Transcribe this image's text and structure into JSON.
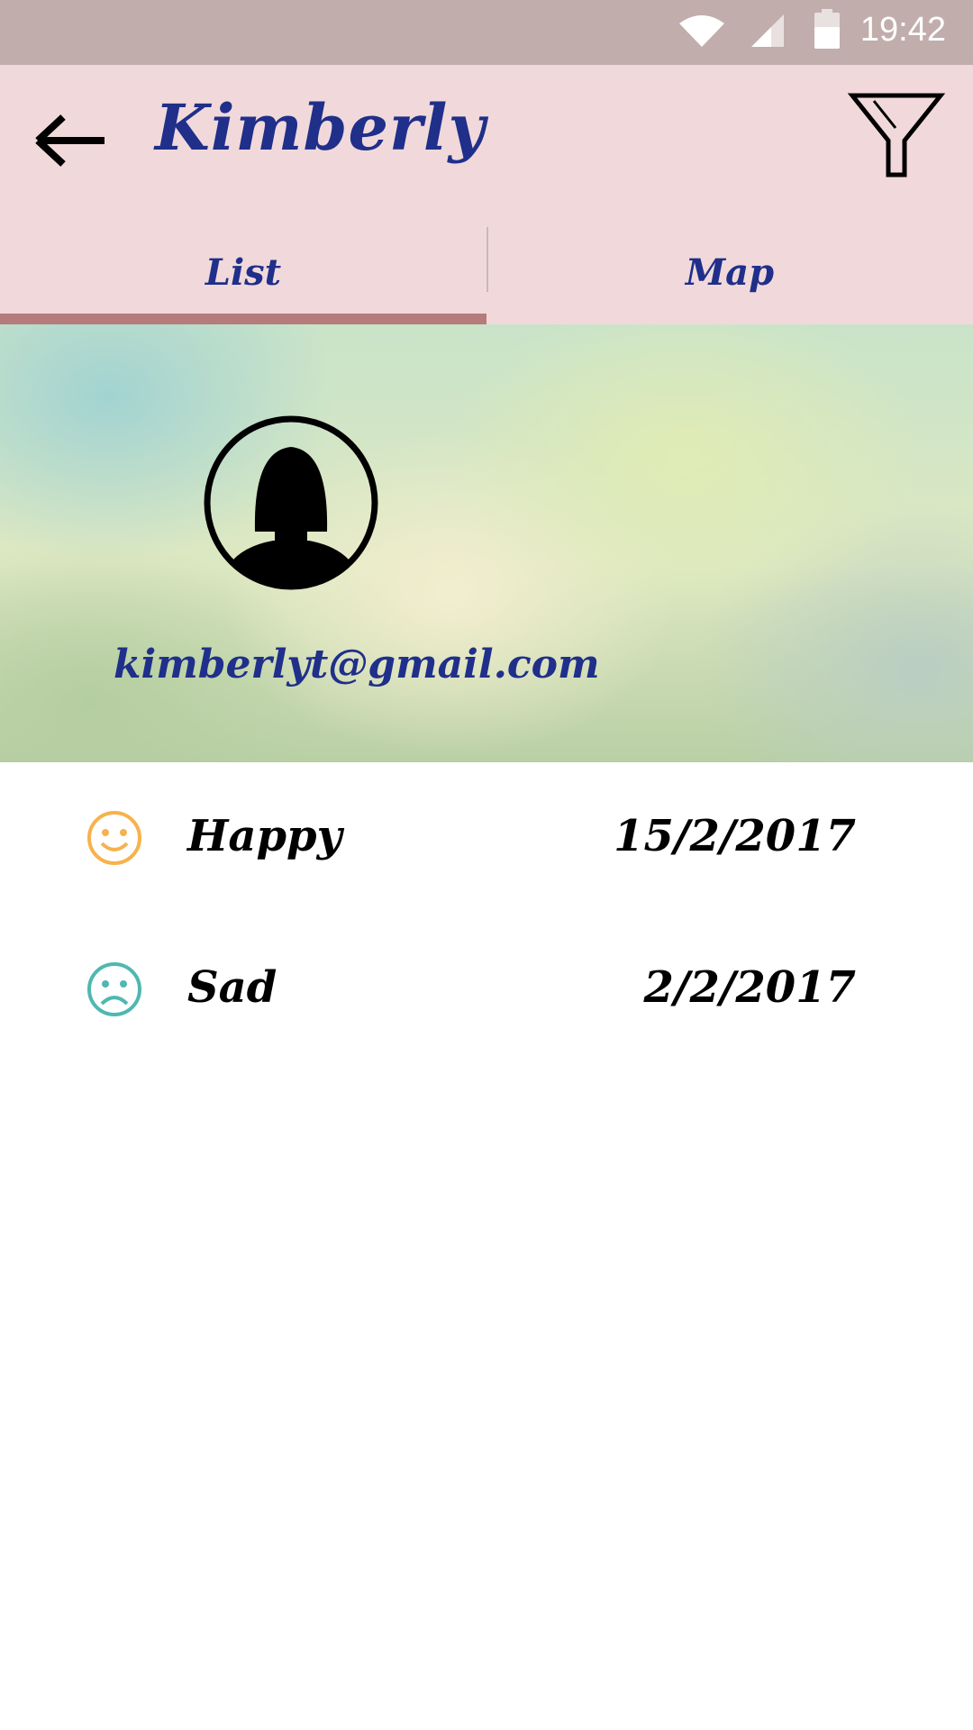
{
  "status_bar": {
    "time": "19:42",
    "icons": [
      "wifi-icon",
      "cell-signal-icon",
      "battery-icon"
    ]
  },
  "app_bar": {
    "back_icon": "arrow-left-icon",
    "title": "Kimberly",
    "filter_icon": "funnel-icon"
  },
  "tabs": [
    {
      "label": "List",
      "selected": true
    },
    {
      "label": "Map",
      "selected": false
    }
  ],
  "profile": {
    "avatar_icon": "female-avatar-icon",
    "email": "kimberlyt@gmail.com"
  },
  "moods": [
    {
      "icon": "smile-icon",
      "label": "Happy",
      "date": "15/2/2017",
      "color": "#f7b24c"
    },
    {
      "icon": "frown-icon",
      "label": "Sad",
      "date": "2/2/2017",
      "color": "#4fb8b0"
    }
  ],
  "colors": {
    "status_bar": "#c1adac",
    "app_bar": "#f1d9db",
    "accent_text": "#1f2f8a",
    "tab_indicator": "#b67b7b"
  }
}
